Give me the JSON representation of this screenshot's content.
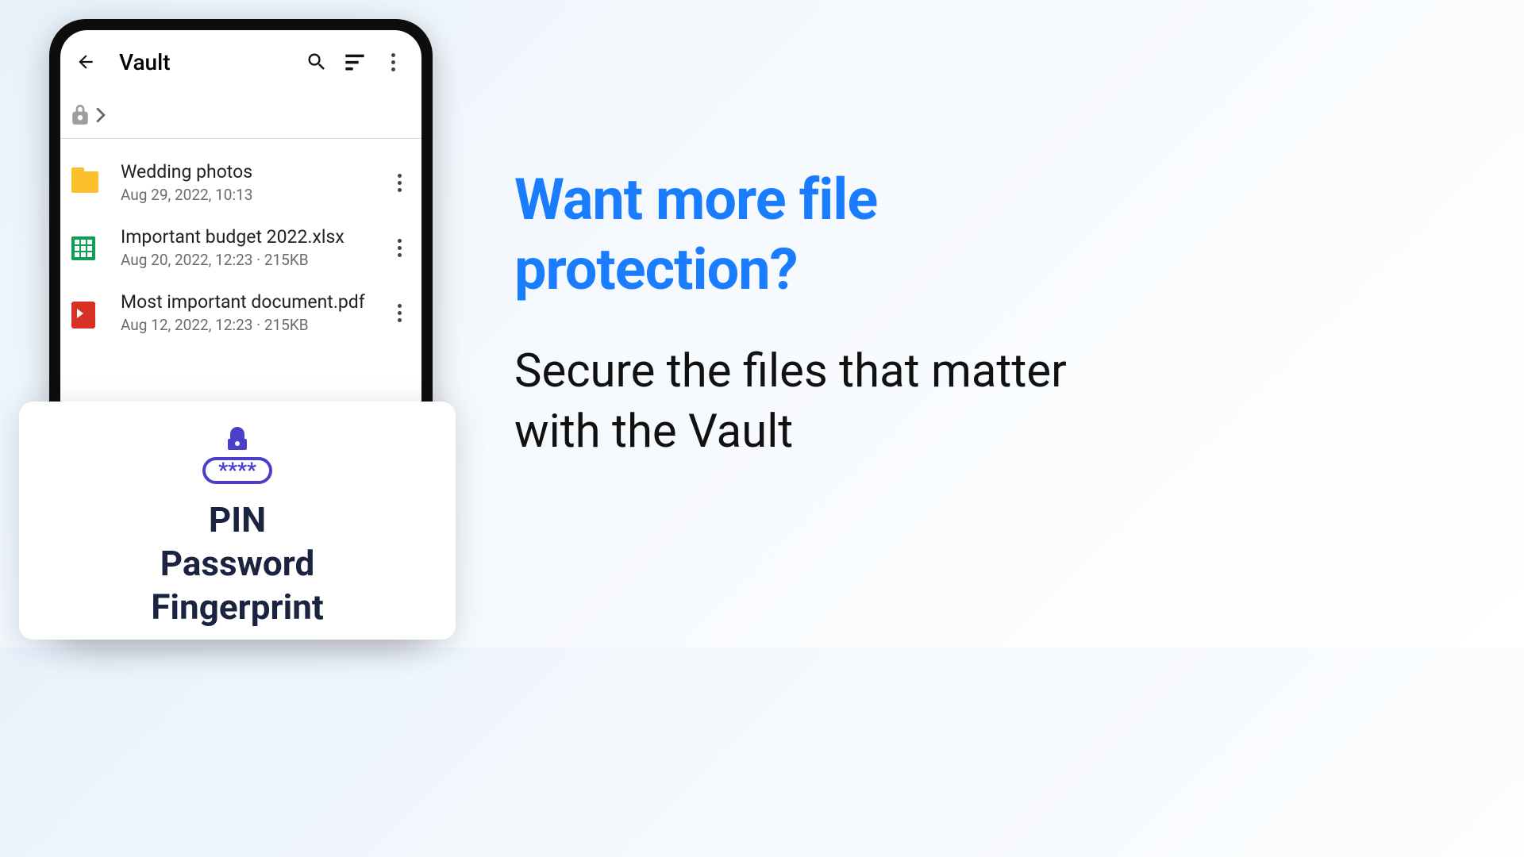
{
  "appbar": {
    "title": "Vault"
  },
  "files": [
    {
      "icon": "folder",
      "name": "Wedding photos",
      "meta": "Aug 29, 2022, 10:13"
    },
    {
      "icon": "xlsx",
      "name": "Important budget 2022.xlsx",
      "meta": "Aug 20, 2022, 12:23 · 215KB"
    },
    {
      "icon": "pdf",
      "name": "Most important document.pdf",
      "meta": "Aug 12, 2022, 12:23 · 215KB"
    }
  ],
  "popup": {
    "pin_field": "****",
    "methods": [
      "PIN",
      "Password",
      "Fingerprint"
    ]
  },
  "marketing": {
    "headline": "Want more file protection?",
    "subline": "Secure the files that matter with the Vault"
  },
  "colors": {
    "accent": "#1a7cff",
    "popup_purple": "#4b3ec9"
  }
}
